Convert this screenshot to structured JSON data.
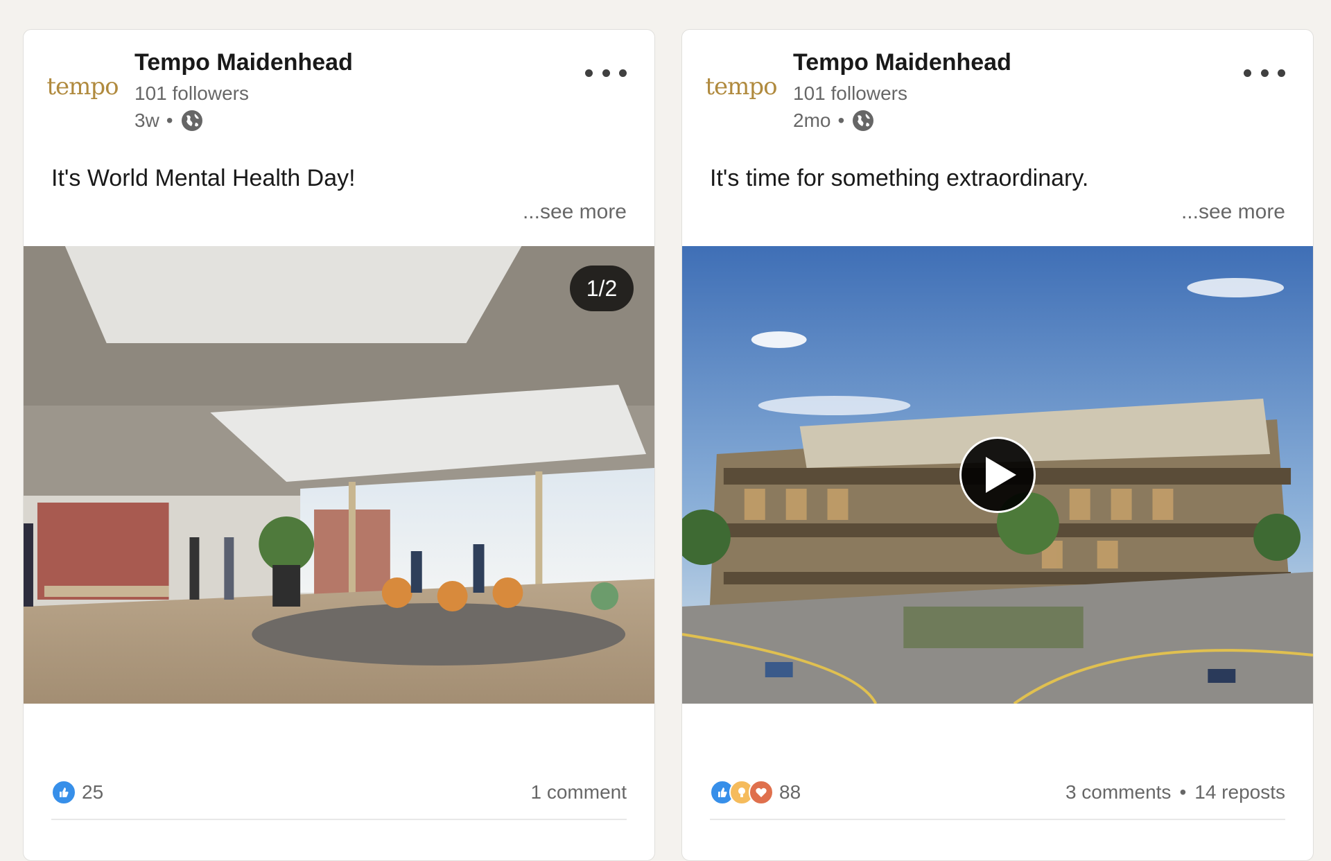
{
  "posts": [
    {
      "author": "Tempo Maidenhead",
      "logo_text": "tempo",
      "followers": "101 followers",
      "age": "3w",
      "separator": "•",
      "text": "It's World Mental Health Day!",
      "see_more": "...see more",
      "media_type": "image",
      "media_counter": "1/2",
      "reaction_icons": [
        "like-icon"
      ],
      "reaction_count": "25",
      "comments": "1 comment",
      "reposts": ""
    },
    {
      "author": "Tempo Maidenhead",
      "logo_text": "tempo",
      "followers": "101 followers",
      "age": "2mo",
      "separator": "•",
      "text": "It's time for something extraordinary.",
      "see_more": "...see more",
      "media_type": "video",
      "media_counter": "",
      "reaction_icons": [
        "like-icon",
        "insightful-icon",
        "love-icon"
      ],
      "reaction_count": "88",
      "comments": "3 comments",
      "dot": "•",
      "reposts": "14 reposts"
    }
  ],
  "colors": {
    "brand_gold": "#b08a3e",
    "like_blue": "#378fe9",
    "insight_yellow": "#f5bb5c",
    "love_red": "#df704d"
  }
}
